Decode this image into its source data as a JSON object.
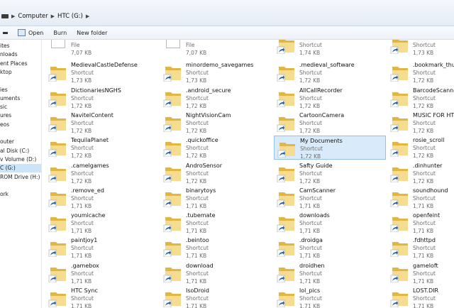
{
  "breadcrumb": {
    "root": "Computer",
    "current": "HTC (G:)"
  },
  "toolbar": {
    "open": "Open",
    "burn": "Burn",
    "new_folder": "New folder"
  },
  "sidebar": [
    {
      "label": "ites",
      "selected": false
    },
    {
      "label": "nloads",
      "selected": false
    },
    {
      "label": "ent Places",
      "selected": false
    },
    {
      "label": "ktop",
      "selected": false
    },
    {
      "label": "",
      "selected": false
    },
    {
      "label": "ies",
      "selected": false
    },
    {
      "label": "uments",
      "selected": false
    },
    {
      "label": "sic",
      "selected": false
    },
    {
      "label": "ures",
      "selected": false
    },
    {
      "label": "eos",
      "selected": false
    },
    {
      "label": "",
      "selected": false
    },
    {
      "label": "outer",
      "selected": false
    },
    {
      "label": "al Disk (C:)",
      "selected": false
    },
    {
      "label": "v Volume (D:)",
      "selected": false
    },
    {
      "label": "C (G:)",
      "selected": true
    },
    {
      "label": "ROM Drive (H:) S",
      "selected": false
    },
    {
      "label": "",
      "selected": false
    },
    {
      "label": "ork",
      "selected": false
    }
  ],
  "colors": {
    "folder_back": "#e2b645",
    "folder_front": "#f6dc8e",
    "selection": "#d9ebfa",
    "selection_border": "#95c1e8",
    "shortcut_arrow": "#1a5fb4"
  },
  "items": [
    {
      "name": "",
      "type": "File",
      "size": "7,07 KB",
      "icon": "file-icon"
    },
    {
      "name": "",
      "type": "File",
      "size": "7,07 KB",
      "icon": "file-icon"
    },
    {
      "name": "",
      "type": "Shortcut",
      "size": "1,74 KB",
      "icon": "folder-shortcut-icon"
    },
    {
      "name": "",
      "type": "Shortcut",
      "size": "1,73 KB",
      "icon": "folder-shortcut-icon"
    },
    {
      "name": "MedievalCastleDefense",
      "type": "Shortcut",
      "size": "1,73 KB",
      "icon": "folder-shortcut-icon"
    },
    {
      "name": "minordemo_savegames",
      "type": "Shortcut",
      "size": "1,73 KB",
      "icon": "folder-shortcut-icon"
    },
    {
      "name": ".medieval_software",
      "type": "Shortcut",
      "size": "1,72 KB",
      "icon": "folder-shortcut-icon"
    },
    {
      "name": ".bookmark_thum",
      "type": "Shortcut",
      "size": "1,72 KB",
      "icon": "folder-shortcut-icon"
    },
    {
      "name": "DictionariesNGHS",
      "type": "Shortcut",
      "size": "1,72 KB",
      "icon": "folder-shortcut-icon"
    },
    {
      "name": ".android_secure",
      "type": "Shortcut",
      "size": "1,72 KB",
      "icon": "folder-shortcut-icon"
    },
    {
      "name": "AllCallRecorder",
      "type": "Shortcut",
      "size": "1,72 KB",
      "icon": "folder-shortcut-icon"
    },
    {
      "name": "BarcodeScanner",
      "type": "Shortcut",
      "size": "1,72 KB",
      "icon": "folder-shortcut-icon"
    },
    {
      "name": "NavitelContent",
      "type": "Shortcut",
      "size": "1,72 KB",
      "icon": "folder-shortcut-icon"
    },
    {
      "name": "NightVisionCam",
      "type": "Shortcut",
      "size": "1,72 KB",
      "icon": "folder-shortcut-icon"
    },
    {
      "name": "CartoonCamera",
      "type": "Shortcut",
      "size": "1,72 KB",
      "icon": "folder-shortcut-icon"
    },
    {
      "name": "MUSIC FOR HTC",
      "type": "Shortcut",
      "size": "1,72 KB",
      "icon": "folder-shortcut-icon"
    },
    {
      "name": "TequilaPlanet",
      "type": "Shortcut",
      "size": "1,72 KB",
      "icon": "folder-shortcut-icon"
    },
    {
      "name": ".quickoffice",
      "type": "Shortcut",
      "size": "1,72 KB",
      "icon": "folder-shortcut-icon"
    },
    {
      "name": "My Documents",
      "type": "Shortcut",
      "size": "1,72 KB",
      "icon": "folder-shortcut-icon",
      "selected": true
    },
    {
      "name": "rosie_scroll",
      "type": "Shortcut",
      "size": "1,72 KB",
      "icon": "folder-shortcut-icon"
    },
    {
      "name": ".camelgames",
      "type": "Shortcut",
      "size": "1,72 KB",
      "icon": "folder-shortcut-icon"
    },
    {
      "name": "AndroSensor",
      "type": "Shortcut",
      "size": "1,72 KB",
      "icon": "folder-shortcut-icon"
    },
    {
      "name": "Safty Guide",
      "type": "Shortcut",
      "size": "1,72 KB",
      "icon": "folder-shortcut-icon"
    },
    {
      "name": ".dinhunter",
      "type": "Shortcut",
      "size": "1,72 KB",
      "icon": "folder-shortcut-icon"
    },
    {
      "name": ".remove_ed",
      "type": "Shortcut",
      "size": "1,71 KB",
      "icon": "folder-shortcut-icon"
    },
    {
      "name": "binarytoys",
      "type": "Shortcut",
      "size": "1,71 KB",
      "icon": "folder-shortcut-icon"
    },
    {
      "name": "CamScanner",
      "type": "Shortcut",
      "size": "1,71 KB",
      "icon": "folder-shortcut-icon"
    },
    {
      "name": "soundhound",
      "type": "Shortcut",
      "size": "1,71 KB",
      "icon": "folder-shortcut-icon"
    },
    {
      "name": "youmicache",
      "type": "Shortcut",
      "size": "1,71 KB",
      "icon": "folder-shortcut-icon"
    },
    {
      "name": ".tubemate",
      "type": "Shortcut",
      "size": "1,71 KB",
      "icon": "folder-shortcut-icon"
    },
    {
      "name": "downloads",
      "type": "Shortcut",
      "size": "1,71 KB",
      "icon": "folder-shortcut-icon"
    },
    {
      "name": "openfeint",
      "type": "Shortcut",
      "size": "1,71 KB",
      "icon": "folder-shortcut-icon"
    },
    {
      "name": "paintjoy1",
      "type": "Shortcut",
      "size": "1,71 KB",
      "icon": "folder-shortcut-icon"
    },
    {
      "name": ".beintoo",
      "type": "Shortcut",
      "size": "1,71 KB",
      "icon": "folder-shortcut-icon"
    },
    {
      "name": ".droidga",
      "type": "Shortcut",
      "size": "1,71 KB",
      "icon": "folder-shortcut-icon"
    },
    {
      "name": ".fdhttpd",
      "type": "Shortcut",
      "size": "1,71 KB",
      "icon": "folder-shortcut-icon"
    },
    {
      "name": ".gamebox",
      "type": "Shortcut",
      "size": "1,71 KB",
      "icon": "folder-shortcut-icon"
    },
    {
      "name": "download",
      "type": "Shortcut",
      "size": "1,71 KB",
      "icon": "folder-shortcut-icon"
    },
    {
      "name": "droidhen",
      "type": "Shortcut",
      "size": "1,71 KB",
      "icon": "folder-shortcut-icon"
    },
    {
      "name": "gameloft",
      "type": "Shortcut",
      "size": "1,71 KB",
      "icon": "folder-shortcut-icon"
    },
    {
      "name": "HTC Sync",
      "type": "Shortcut",
      "size": "1,71 KB",
      "icon": "folder-shortcut-icon"
    },
    {
      "name": "IsoDroid",
      "type": "Shortcut",
      "size": "1,71 KB",
      "icon": "folder-shortcut-icon"
    },
    {
      "name": "lol_pics",
      "type": "Shortcut",
      "size": "1,71 KB",
      "icon": "folder-shortcut-icon"
    },
    {
      "name": "LOST.DIR",
      "type": "Shortcut",
      "size": "1,71 KB",
      "icon": "folder-shortcut-icon"
    }
  ]
}
